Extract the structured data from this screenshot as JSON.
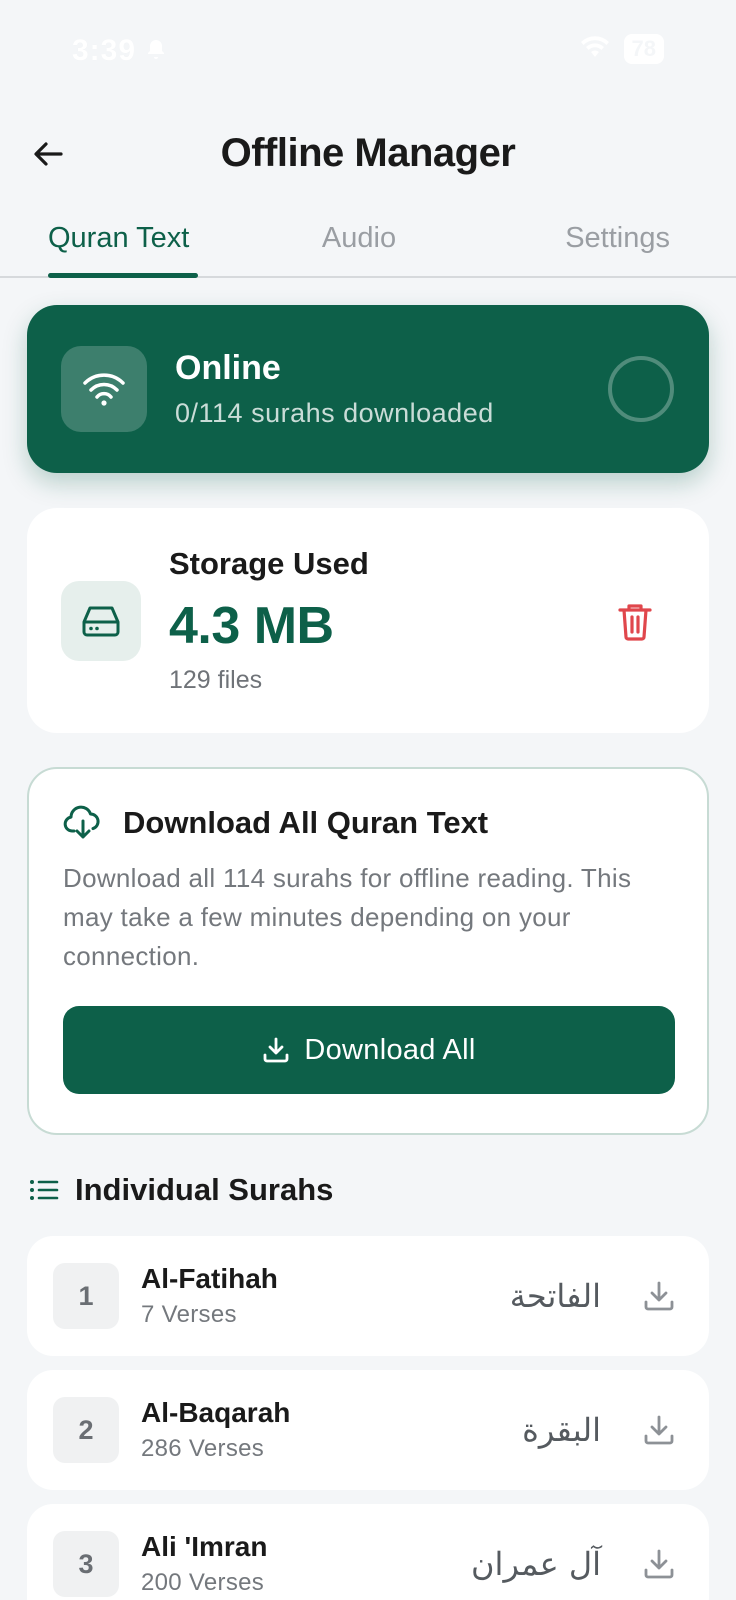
{
  "status_bar": {
    "time": "3:39",
    "battery": "78"
  },
  "header": {
    "title": "Offline Manager"
  },
  "tabs": [
    {
      "label": "Quran Text",
      "active": true
    },
    {
      "label": "Audio",
      "active": false
    },
    {
      "label": "Settings",
      "active": false
    }
  ],
  "online_card": {
    "title": "Online",
    "subtitle": "0/114 surahs downloaded",
    "progress": 0
  },
  "storage_card": {
    "label": "Storage Used",
    "value": "4.3 MB",
    "files": "129 files"
  },
  "download_card": {
    "title": "Download All Quran Text",
    "description": "Download all 114 surahs for offline reading. This may take a few minutes depending on your connection.",
    "button_label": "Download All"
  },
  "section": {
    "title": "Individual Surahs"
  },
  "surahs": [
    {
      "number": "1",
      "name": "Al-Fatihah",
      "verses": "7 Verses",
      "arabic": "الفاتحة"
    },
    {
      "number": "2",
      "name": "Al-Baqarah",
      "verses": "286 Verses",
      "arabic": "البقرة"
    },
    {
      "number": "3",
      "name": "Ali 'Imran",
      "verses": "200 Verses",
      "arabic": "آل عمران"
    }
  ],
  "colors": {
    "primary": "#0d6049",
    "danger": "#e0474c",
    "background": "#f4f6f8"
  }
}
